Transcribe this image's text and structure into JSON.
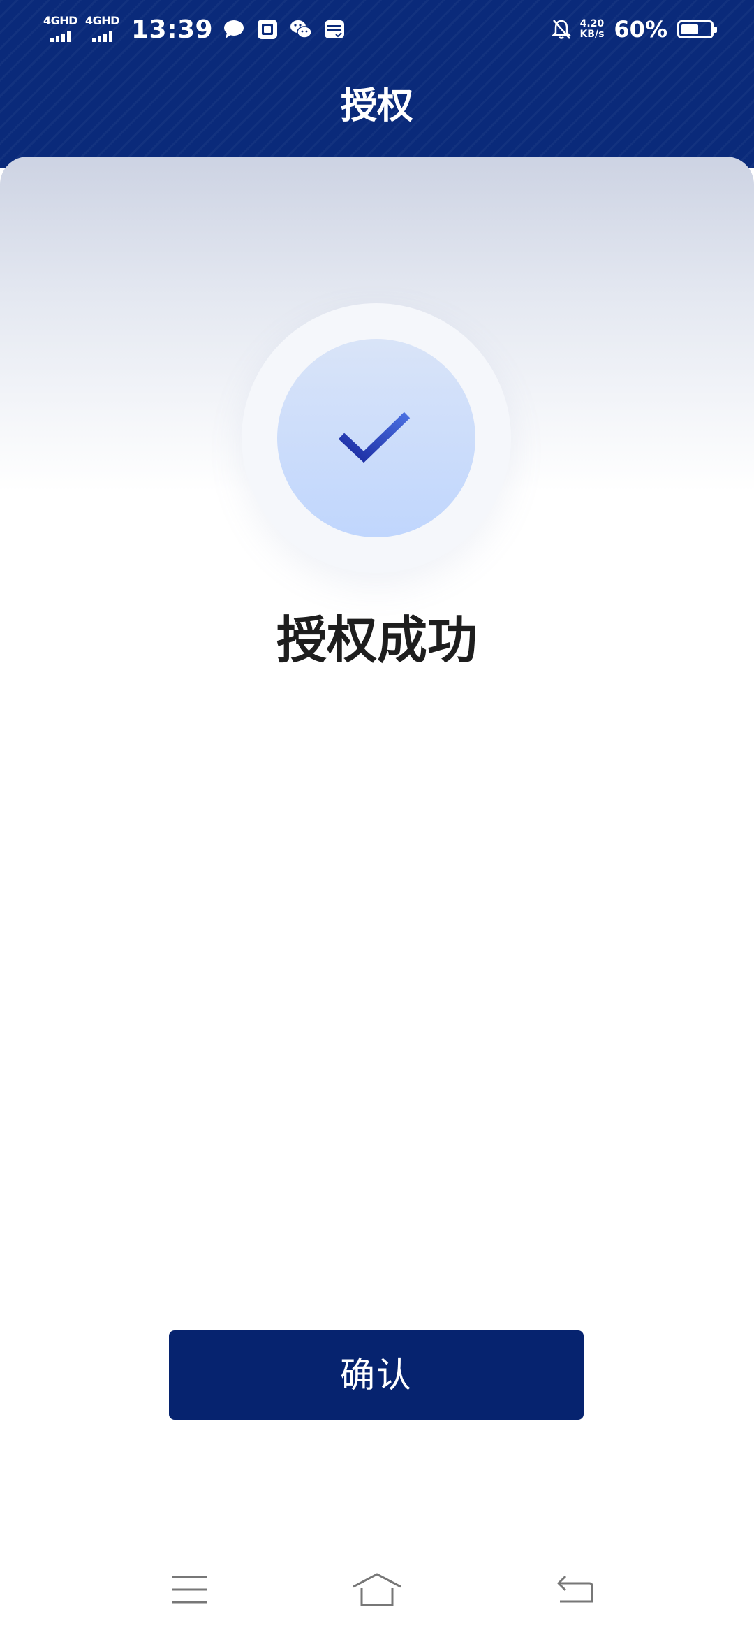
{
  "status_bar": {
    "sim1_tech": "4GHD",
    "sim2_tech": "4GHD",
    "time": "13:39",
    "notification_icons": [
      "chat-bubble-icon",
      "taobao-icon",
      "wechat-icon",
      "wallet-card-icon"
    ],
    "mute_icon": "bell-off-icon",
    "net_speed_value": "4.20",
    "net_speed_unit": "KB/s",
    "battery_percent": "60%",
    "battery_level": 0.6
  },
  "header": {
    "title": "授权"
  },
  "result": {
    "icon": "checkmark-icon",
    "message": "授权成功"
  },
  "actions": {
    "confirm_label": "确认"
  },
  "nav_bar": {
    "items": [
      "menu-icon",
      "home-icon",
      "back-icon"
    ]
  },
  "colors": {
    "header_bg": "#0a2a7a",
    "button_bg": "#06236f",
    "check_stroke": "#1f33a8",
    "icon_circle": "#c0d6fd"
  }
}
